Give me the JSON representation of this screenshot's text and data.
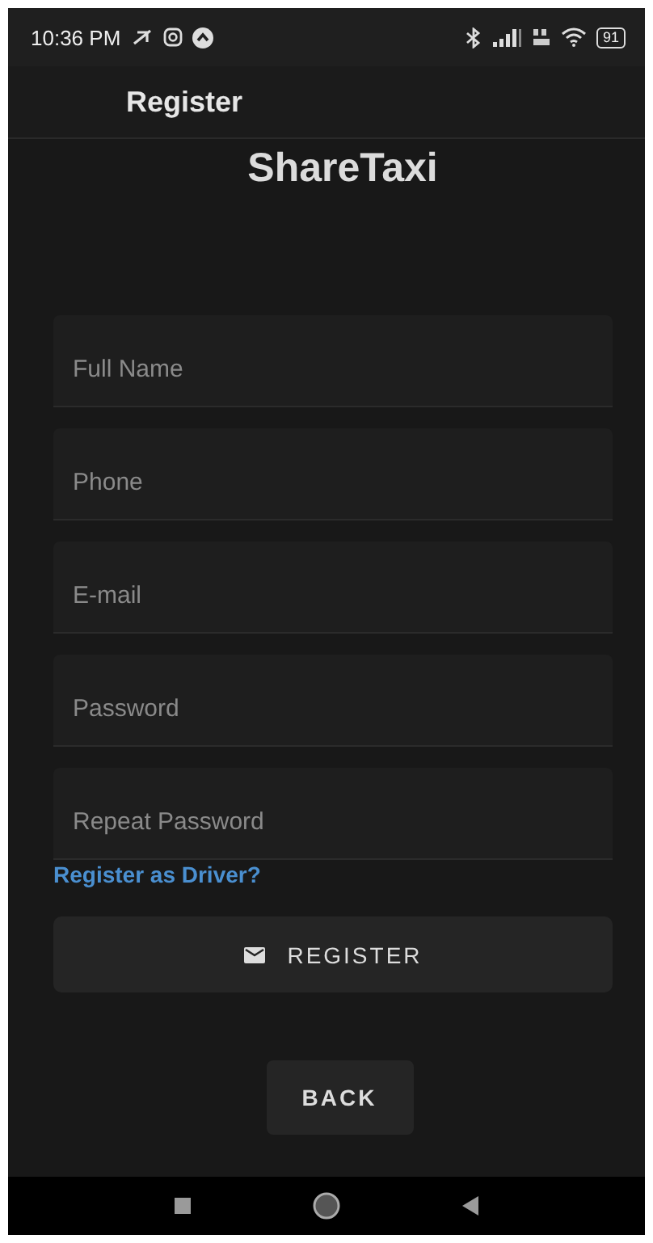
{
  "status_bar": {
    "time": "10:36 PM",
    "battery": "91"
  },
  "header": {
    "title": "Register"
  },
  "app_name": "ShareTaxi",
  "fields": [
    {
      "placeholder": "Full Name"
    },
    {
      "placeholder": "Phone"
    },
    {
      "placeholder": "E-mail"
    },
    {
      "placeholder": "Password"
    },
    {
      "placeholder": "Repeat Password"
    }
  ],
  "driver_link": "Register as Driver?",
  "register_button": "REGISTER",
  "back_button": "BACK"
}
